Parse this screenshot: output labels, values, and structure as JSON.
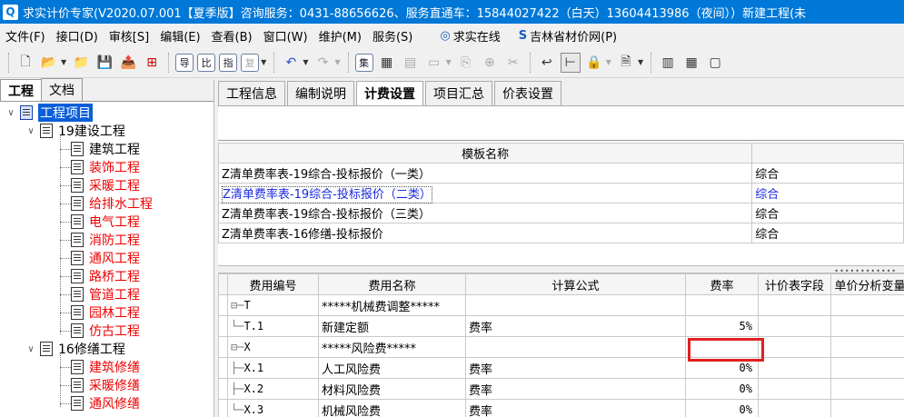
{
  "window": {
    "title": "求实计价专家(V2020.07.001【夏季版】咨询服务：0431-88656626、服务直通车：15844027422（白天）13604413986（夜间））新建工程(未"
  },
  "menu": {
    "file": "文件(F)",
    "interface": "接口(D)",
    "audit": "审核[S]",
    "edit": "编辑(E)",
    "view": "查看(B)",
    "window": "窗口(W)",
    "maintain": "维护(M)",
    "service": "服务(S)",
    "online": "求实在线",
    "price_site": "吉林省材价网(P)"
  },
  "toolbar": {
    "btn_import": "导",
    "btn_compare": "比",
    "btn_index": "指",
    "btn_copy": "复",
    "btn_set": "集"
  },
  "left": {
    "tabs": [
      "工程",
      "文档"
    ],
    "root": "工程项目",
    "groups": [
      {
        "label": "19建设工程",
        "items": [
          {
            "label": "建筑工程",
            "red": false
          },
          {
            "label": "装饰工程",
            "red": true
          },
          {
            "label": "采暖工程",
            "red": true
          },
          {
            "label": "给排水工程",
            "red": true
          },
          {
            "label": "电气工程",
            "red": true
          },
          {
            "label": "消防工程",
            "red": true
          },
          {
            "label": "通风工程",
            "red": true
          },
          {
            "label": "路桥工程",
            "red": true
          },
          {
            "label": "管道工程",
            "red": true
          },
          {
            "label": "园林工程",
            "red": true
          },
          {
            "label": "仿古工程",
            "red": true
          }
        ]
      },
      {
        "label": "16修缮工程",
        "items": [
          {
            "label": "建筑修缮",
            "red": true
          },
          {
            "label": "采暖修缮",
            "red": true
          },
          {
            "label": "通风修缮",
            "red": true
          }
        ]
      }
    ]
  },
  "tabs": [
    "工程信息",
    "编制说明",
    "计费设置",
    "项目汇总",
    "价表设置"
  ],
  "templates": {
    "header": "模板名称",
    "rows": [
      {
        "name": "Z清单费率表-19综合-投标报价（一类）",
        "type": "综合",
        "selected": false
      },
      {
        "name": "Z清单费率表-19综合-投标报价（二类）",
        "type": "综合",
        "selected": true
      },
      {
        "name": "Z清单费率表-19综合-投标报价（三类）",
        "type": "综合",
        "selected": false
      },
      {
        "name": "Z清单费率表-16修缮-投标报价",
        "type": "综合",
        "selected": false
      }
    ]
  },
  "fees": {
    "headers": {
      "code": "费用编号",
      "name": "费用名称",
      "formula": "计算公式",
      "rate": "费率",
      "price_field": "计价表字段",
      "analysis": "单价分析变量"
    },
    "rows": [
      {
        "code": "T",
        "name": "*****机械费调整*****",
        "formula": "",
        "rate": "",
        "prefix": "⊟─"
      },
      {
        "code": "T.1",
        "name": "新建定额",
        "formula": "费率",
        "rate": "5%",
        "prefix": "  └─"
      },
      {
        "code": "X",
        "name": "*****风险费*****",
        "formula": "",
        "rate": "",
        "prefix": "⊟─"
      },
      {
        "code": "X.1",
        "name": "人工风险费",
        "formula": "费率",
        "rate": "0%",
        "prefix": "  ├─"
      },
      {
        "code": "X.2",
        "name": "材料风险费",
        "formula": "费率",
        "rate": "0%",
        "prefix": "  ├─"
      },
      {
        "code": "X.3",
        "name": "机械风险费",
        "formula": "费率",
        "rate": "0%",
        "prefix": "  └─"
      }
    ]
  },
  "colors": {
    "title_bar": "#0078d7",
    "selection": "#0a5fd8",
    "highlight_box": "#e02020",
    "red_item": "#ee0000"
  }
}
